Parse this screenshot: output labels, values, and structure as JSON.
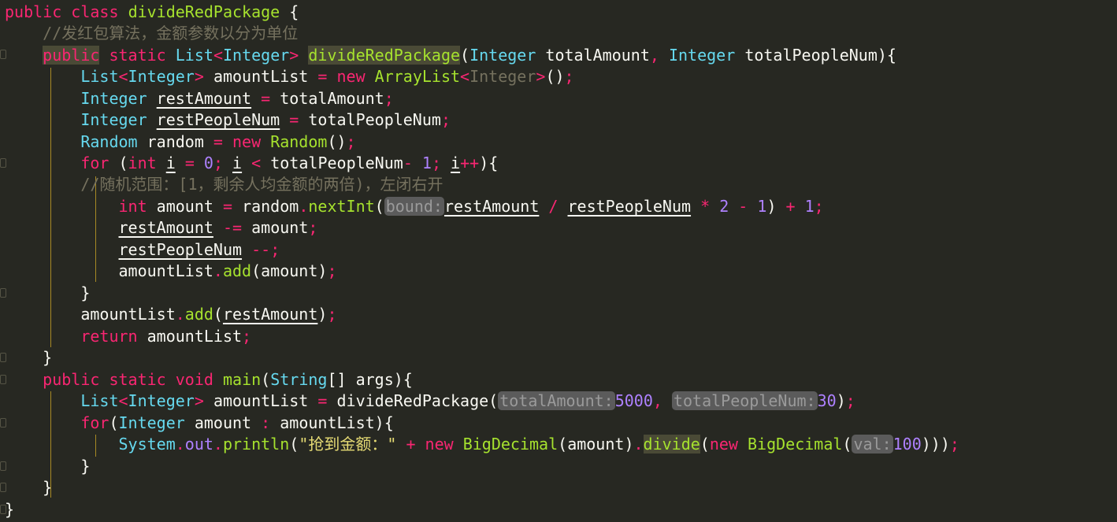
{
  "code": {
    "class_decl": {
      "kw1": "public",
      "kw2": "class",
      "name": "divideRedPackage",
      "brace": " {"
    },
    "comment1": "//发红包算法，金额参数以分为单位",
    "method_decl": {
      "public": "public",
      "static": "static",
      "list": "List",
      "lt": "<",
      "integer": "Integer",
      "gt": ">",
      "name": "divideRedPackage",
      "open": "(",
      "ptype1": "Integer",
      "pname1": "totalAmount",
      "comma": ",",
      "ptype2": "Integer",
      "pname2": "totalPeopleNum",
      "close": "){"
    },
    "l4": {
      "list": "List",
      "lt": "<",
      "integer": "Integer",
      "gt": ">",
      "var": "amountList",
      "eq": "=",
      "new": "new",
      "cls": "ArrayList",
      "lt2": "<",
      "integer2": "Integer",
      "gt2": ">",
      "paren": "()",
      "semi": ";"
    },
    "l5": {
      "type": "Integer",
      "var": "restAmount",
      "eq": "=",
      "val": "totalAmount",
      "semi": ";"
    },
    "l6": {
      "type": "Integer",
      "var": "restPeopleNum",
      "eq": "=",
      "val": "totalPeopleNum",
      "semi": ";"
    },
    "l7": {
      "type": "Random",
      "var": "random",
      "eq": "=",
      "new": "new",
      "cls": "Random",
      "paren": "()",
      "semi": ";"
    },
    "l8": {
      "for": "for",
      "open": "(",
      "int": "int",
      "i1": "i",
      "eq": "=",
      "zero": "0",
      "semi1": ";",
      "i2": "i",
      "lt": "<",
      "total": "totalPeopleNum",
      "minus": "-",
      "one": "1",
      "semi2": ";",
      "i3": "i",
      "pp": "++",
      "close": "){"
    },
    "comment2": "//随机范围：[1，剩余人均金额的两倍)，左闭右开",
    "l10": {
      "int": "int",
      "var": "amount",
      "eq": "=",
      "obj": "random",
      "dot": ".",
      "fn": "nextInt",
      "open": "(",
      "hint": "bound:",
      "ra": "restAmount",
      "div": "/",
      "rp": "restPeopleNum",
      "mul": "*",
      "two": "2",
      "minus": "-",
      "one": "1",
      "close": ")",
      "plus": "+",
      "one2": "1",
      "semi": ";"
    },
    "l11": {
      "var": "restAmount",
      "op": "-=",
      "val": "amount",
      "semi": ";"
    },
    "l12": {
      "var": "restPeopleNum",
      "op": "--",
      "semi": ";"
    },
    "l13": {
      "obj": "amountList",
      "dot": ".",
      "fn": "add",
      "open": "(",
      "arg": "amount",
      "close": ")",
      "semi": ";"
    },
    "l14": "}",
    "l15": {
      "obj": "amountList",
      "dot": ".",
      "fn": "add",
      "open": "(",
      "arg": "restAmount",
      "close": ")",
      "semi": ";"
    },
    "l16": {
      "ret": "return",
      "val": "amountList",
      "semi": ";"
    },
    "l17": "}",
    "l18": {
      "public": "public",
      "static": "static",
      "void": "void",
      "name": "main",
      "open": "(",
      "type": "String",
      "arr": "[]",
      "arg": "args",
      "close": "){"
    },
    "l19": {
      "list": "List",
      "lt": "<",
      "integer": "Integer",
      "gt": ">",
      "var": "amountList",
      "eq": "=",
      "fn": "divideRedPackage",
      "open": "(",
      "hint1": "totalAmount:",
      "v1": "5000",
      "comma": ",",
      "hint2": "totalPeopleNum:",
      "v2": "30",
      "close": ")",
      "semi": ";"
    },
    "l20": {
      "for": "for",
      "open": "(",
      "type": "Integer",
      "var": "amount",
      "colon": ":",
      "coll": "amountList",
      "close": "){"
    },
    "l21": {
      "sys": "System",
      "dot1": ".",
      "out": "out",
      "dot2": ".",
      "fn": "println",
      "open": "(",
      "str": "\"抢到金额：\"",
      "plus": "+",
      "new1": "new",
      "cls1": "BigDecimal",
      "open2": "(",
      "arg": "amount",
      "close2": ")",
      "dot3": ".",
      "fn2": "divide",
      "open3": "(",
      "new2": "new",
      "cls2": "BigDecimal",
      "open4": "(",
      "hint": "val:",
      "val": "100",
      "close": ")))",
      "semi": ";"
    },
    "l22": "}",
    "l23": "}",
    "l24": "}"
  }
}
